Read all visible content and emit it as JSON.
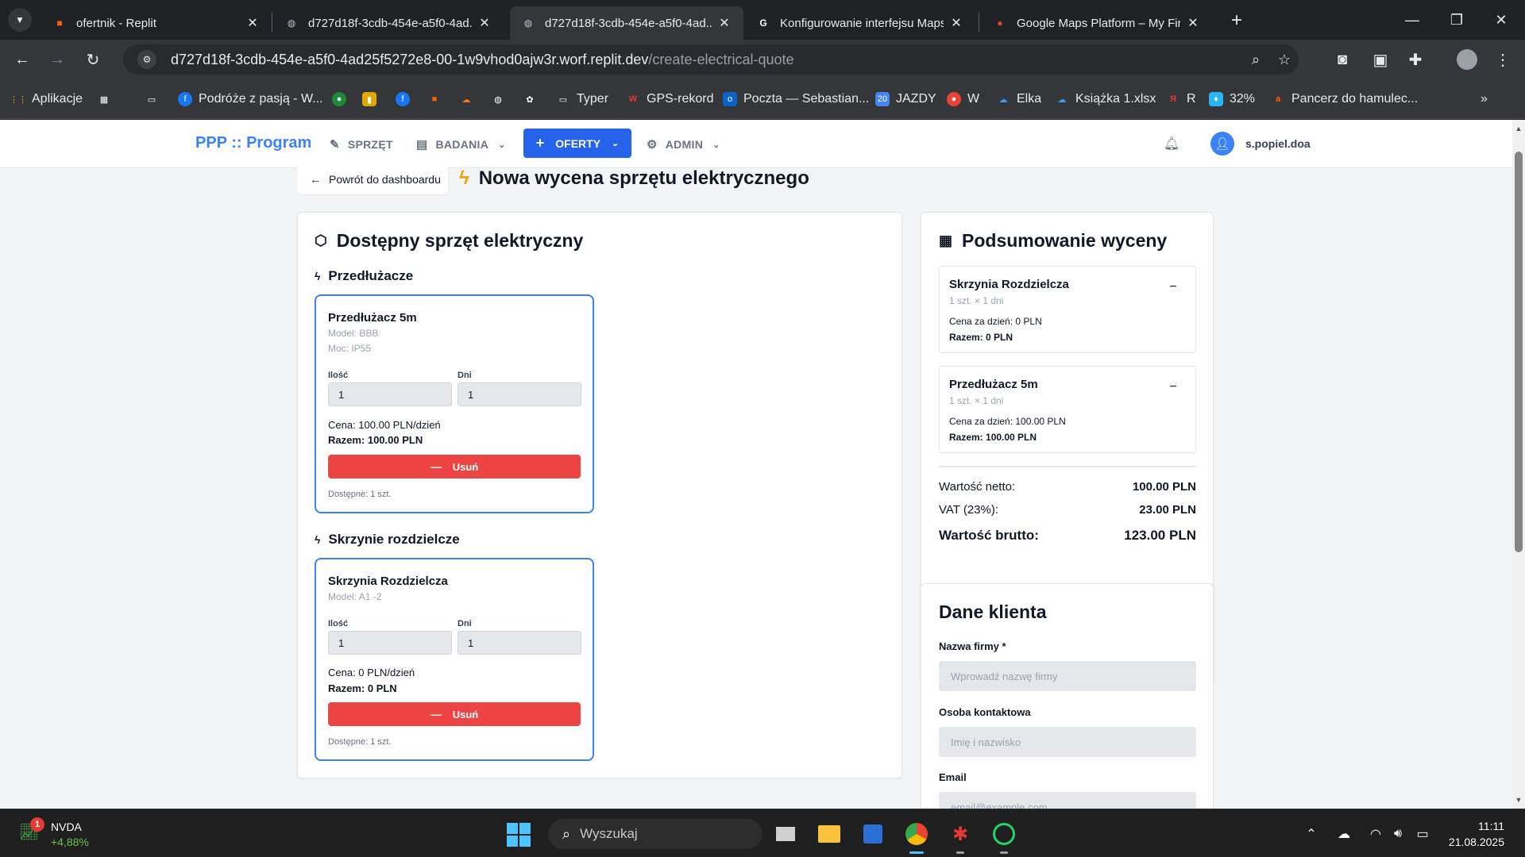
{
  "browser": {
    "tabs": [
      {
        "title": "ofertnik - Replit",
        "icon": "replit-icon",
        "active": false
      },
      {
        "title": "d727d18f-3cdb-454e-a5f0-4ad...",
        "icon": "globe-icon",
        "active": false
      },
      {
        "title": "d727d18f-3cdb-454e-a5f0-4ad...",
        "icon": "globe-icon",
        "active": true
      },
      {
        "title": "Konfigurowanie interfejsu Maps...",
        "icon": "google-icon",
        "active": false
      },
      {
        "title": "Google Maps Platform – My Fir...",
        "icon": "maps-pin-icon",
        "active": false
      }
    ],
    "url_host": "d727d18f-3cdb-454e-a5f0-4ad25f5272e8-00-1w9vhod0ajw3r.worf.replit.dev",
    "url_path": "/create-electrical-quote",
    "bookmarks": [
      "Aplikacje",
      "",
      "",
      "Podróże z pasją - W...",
      "",
      "",
      "",
      "",
      "",
      "",
      "",
      "Typer",
      "GPS-rekord",
      "Poczta — Sebastian...",
      "JAZDY",
      "W",
      "Elka",
      "Książka 1.xlsx",
      "R",
      "32%",
      "Pancerz do hamulec..."
    ]
  },
  "app": {
    "brand": "PPP :: Program",
    "nav": {
      "sprzet": "SPRZĘT",
      "badania": "BADANIA",
      "oferty": "OFERTY",
      "admin": "ADMIN"
    },
    "username": "s.popiel.doa"
  },
  "page": {
    "back_label": "Powrót do dashboardu",
    "title": "Nowa wycena sprzętu elektrycznego"
  },
  "equipment": {
    "title": "Dostępny sprzęt elektryczny",
    "sections": [
      {
        "title": "Przedłużacze",
        "item": {
          "name": "Przedłużacz 5m",
          "model": "Model: BBB",
          "power": "Moc: IP55",
          "qty_label": "Ilość",
          "qty": "1",
          "days_label": "Dni",
          "days": "1",
          "price": "Cena: 100.00 PLN/dzień",
          "total": "Razem: 100.00 PLN",
          "remove": "Usuń",
          "available": "Dostępne: 1 szt."
        }
      },
      {
        "title": "Skrzynie rozdzielcze",
        "item": {
          "name": "Skrzynia Rozdzielcza",
          "model": "Model: A1 -2",
          "qty_label": "Ilość",
          "qty": "1",
          "days_label": "Dni",
          "days": "1",
          "price": "Cena: 0 PLN/dzień",
          "total": "Razem: 0 PLN",
          "remove": "Usuń",
          "available": "Dostępne: 1 szt."
        }
      }
    ]
  },
  "summary": {
    "title": "Podsumowanie wyceny",
    "items": [
      {
        "name": "Skrzynia Rozdzielcza",
        "qty": "1 szt. × 1 dni",
        "price": "Cena za dzień: 0 PLN",
        "total": "Razem: 0 PLN"
      },
      {
        "name": "Przedłużacz 5m",
        "qty": "1 szt. × 1 dni",
        "price": "Cena za dzień: 100.00 PLN",
        "total": "Razem: 100.00 PLN"
      }
    ],
    "netto_label": "Wartość netto:",
    "netto_value": "100.00 PLN",
    "vat_label": "VAT (23%):",
    "vat_value": "23.00 PLN",
    "brutto_label": "Wartość brutto:",
    "brutto_value": "123.00 PLN"
  },
  "client": {
    "title": "Dane klienta",
    "company_label": "Nazwa firmy *",
    "company_placeholder": "Wprowadź nazwę firmy",
    "contact_label": "Osoba kontaktowa",
    "contact_placeholder": "Imię i nazwisko",
    "email_label": "Email",
    "email_placeholder": "email@example.com"
  },
  "taskbar": {
    "stock_badge": "1",
    "stock_name": "NVDA",
    "stock_change": "+4,88%",
    "search_placeholder": "Wyszukaj",
    "time": "11:11",
    "date": "21.08.2025"
  }
}
